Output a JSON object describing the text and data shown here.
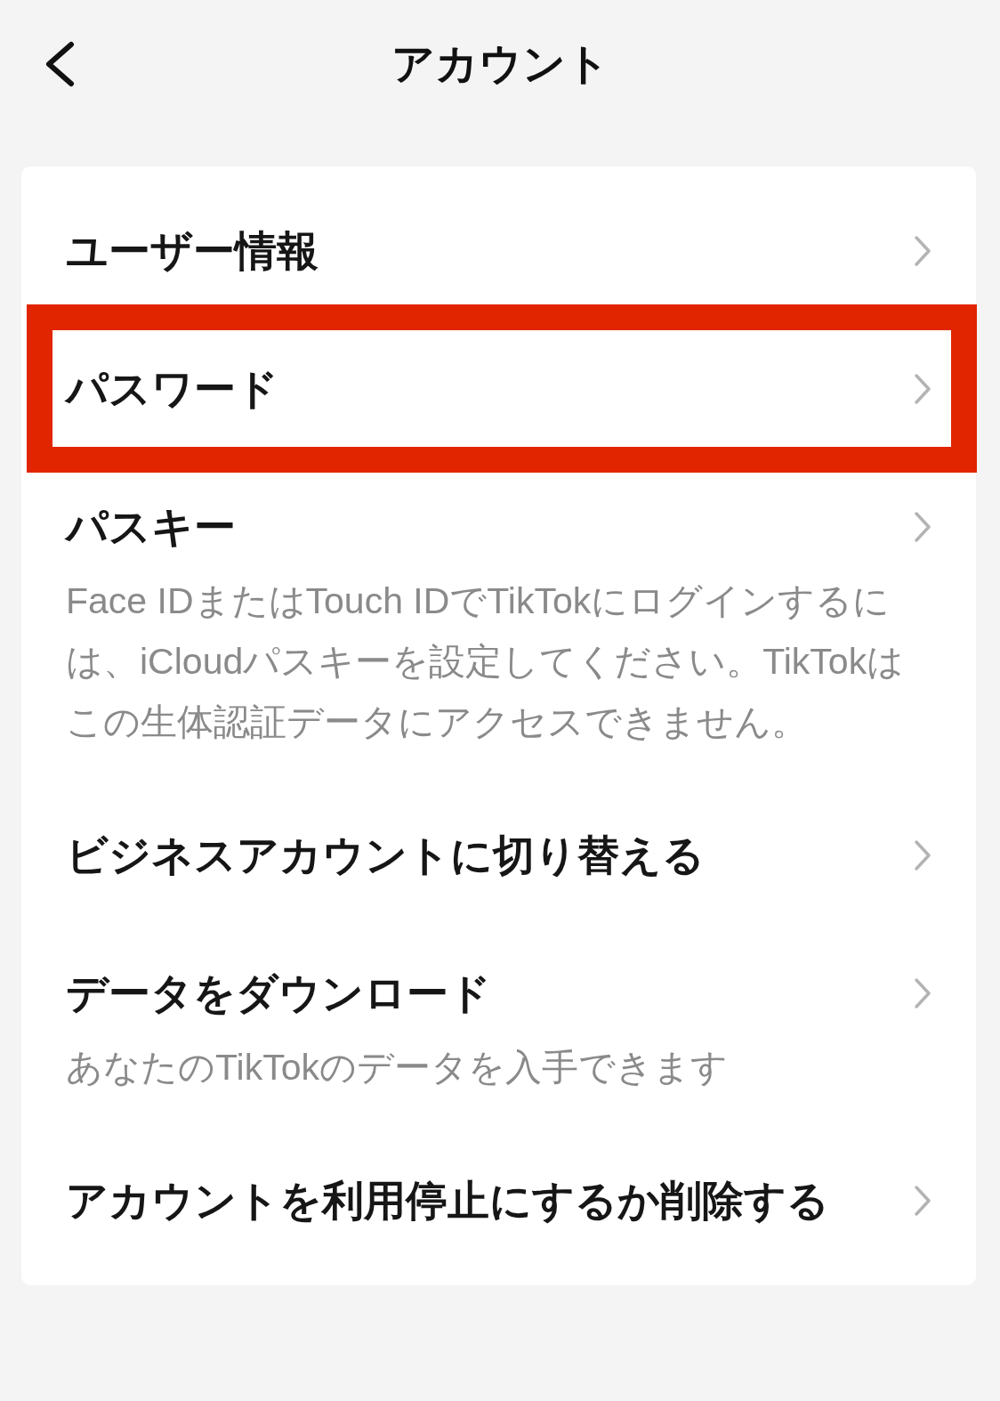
{
  "header": {
    "title": "アカウント"
  },
  "items": [
    {
      "title": "ユーザー情報",
      "highlighted": false
    },
    {
      "title": "パスワード",
      "highlighted": true
    },
    {
      "title": "パスキー",
      "description": "Face IDまたはTouch IDでTikTokにログインするには、iCloudパスキーを設定してください。TikTokはこの生体認証データにアクセスできません。",
      "highlighted": false
    },
    {
      "title": "ビジネスアカウントに切り替える",
      "highlighted": false
    },
    {
      "title": "データをダウンロード",
      "description": "あなたのTikTokのデータを入手できます",
      "highlighted": false
    },
    {
      "title": "アカウントを利用停止にするか削除する",
      "highlighted": false
    }
  ]
}
